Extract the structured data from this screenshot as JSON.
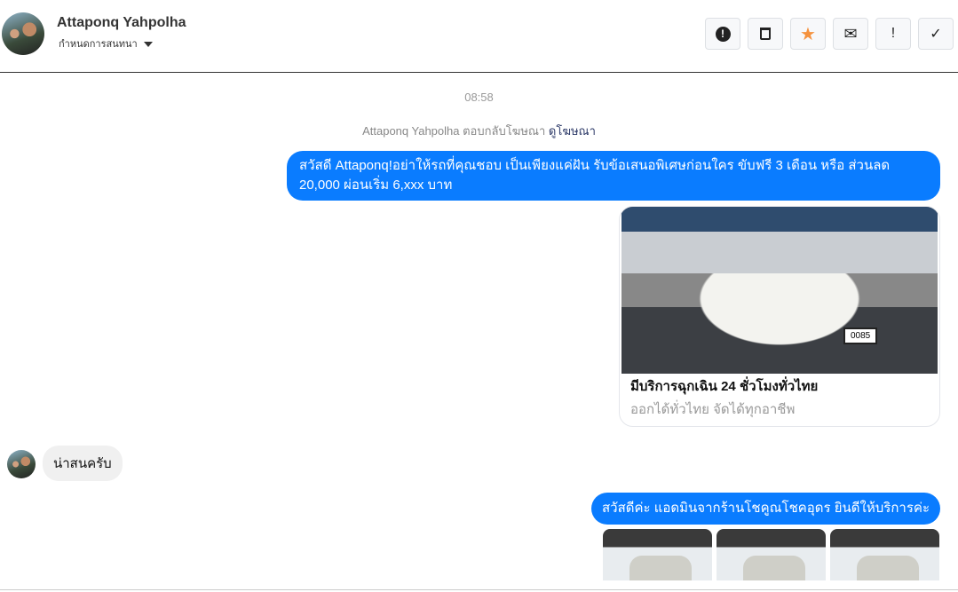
{
  "header": {
    "name": "Attaponq Yahpolha",
    "subtitle": "กำหนดการสนทนา"
  },
  "actions": [
    {
      "icon": "alert-circle-icon",
      "glyph": "❗"
    },
    {
      "icon": "trash-icon",
      "glyph": "🗑"
    },
    {
      "icon": "star-icon",
      "glyph": "★",
      "color": "#f5923e"
    },
    {
      "icon": "envelope-icon",
      "glyph": "✉"
    },
    {
      "icon": "exclamation-icon",
      "glyph": "!"
    },
    {
      "icon": "check-icon",
      "glyph": "✓"
    }
  ],
  "thread": {
    "time": "08:58",
    "reply_note": "Attaponq Yahpolha ตอบกลับโฆษณา",
    "reply_link": "ดูโฆษณา",
    "msg1": "สวัสดี Attaponq!อย่าให้รถที่คุณชอบ เป็นเพียงแค่ฝัน รับข้อเสนอพิเศษก่อนใคร ขับฟรี 3 เดือน หรือ ส่วนลด 20,000 ผ่อนเริ่ม 6,xxx บาท",
    "card": {
      "plate": "0085",
      "title": "มีบริการฉุกเฉิน 24 ชั่วโมงทั่วไทย",
      "subtitle": "ออกได้ทั่วไทย จัดได้ทุกอาชีพ"
    },
    "msg2": "น่าสนครับ",
    "msg3": "สวัสดีค่ะ แอดมินจากร้านโชคูณโชคอุดร ยินดีให้บริการค่ะ"
  },
  "colors": {
    "accent": "#0a7cff"
  }
}
